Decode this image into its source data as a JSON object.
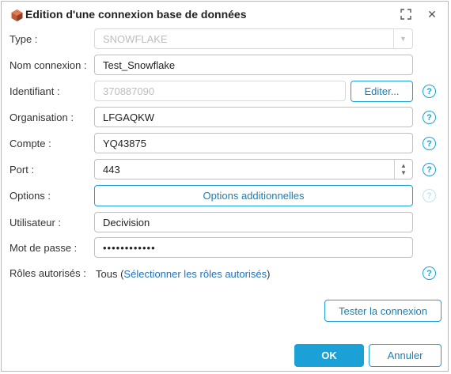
{
  "dialog": {
    "title": "Edition d'une connexion base de données"
  },
  "form": {
    "type_label": "Type :",
    "type_value": "SNOWFLAKE",
    "nom_label": "Nom connexion :",
    "nom_value": "Test_Snowflake",
    "identifiant_label": "Identifiant :",
    "identifiant_value": "370887090",
    "editer_label": "Editer...",
    "organisation_label": "Organisation :",
    "organisation_value": "LFGAQKW",
    "compte_label": "Compte :",
    "compte_value": "YQ43875",
    "port_label": "Port :",
    "port_value": "443",
    "options_label": "Options :",
    "options_button": "Options additionnelles",
    "utilisateur_label": "Utilisateur :",
    "utilisateur_value": "Decivision",
    "password_label": "Mot de passe :",
    "password_value": "••••••••••••",
    "roles_label": "Rôles autorisés :",
    "roles_prefix": "Tous",
    "roles_link": "Sélectionner les rôles autorisés"
  },
  "actions": {
    "test_label": "Tester la connexion",
    "ok_label": "OK",
    "cancel_label": "Annuler"
  },
  "colors": {
    "accent": "#1ba1d6",
    "link": "#1a73c2"
  },
  "icons": [
    "database-icon",
    "maximize-icon",
    "close-icon",
    "help-icon",
    "spinner-up-icon",
    "spinner-down-icon",
    "dropdown-arrow-icon"
  ]
}
